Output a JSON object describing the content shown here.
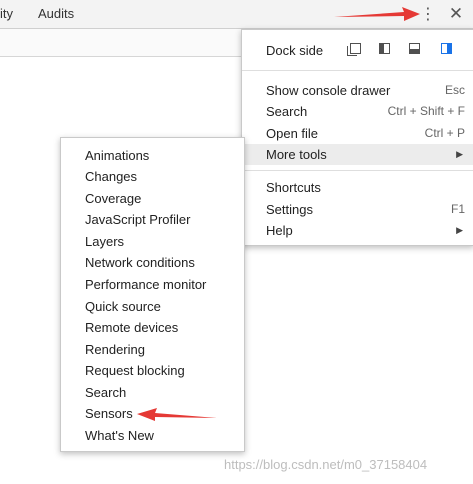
{
  "tabs": {
    "partial": "ity",
    "audits": "Audits"
  },
  "toolbar": {
    "kebab_icon": "more-vertical-icon",
    "close_icon": "close-icon",
    "kebab_glyph": "⋮",
    "close_glyph": "✕"
  },
  "main_menu": {
    "dock_side_label": "Dock side",
    "dock_options": [
      "undock-icon",
      "dock-left-icon",
      "dock-bottom-icon",
      "dock-right-icon"
    ],
    "active_dock": "dock-right-icon",
    "items": [
      {
        "label": "Show console drawer",
        "shortcut": "Esc"
      },
      {
        "label": "Search",
        "shortcut": "Ctrl + Shift + F"
      },
      {
        "label": "Open file",
        "shortcut": "Ctrl + P"
      },
      {
        "label": "More tools",
        "submenu": true,
        "highlighted": true
      },
      {
        "label": "Shortcuts"
      },
      {
        "label": "Settings",
        "shortcut": "F1"
      },
      {
        "label": "Help",
        "submenu": true
      }
    ],
    "submenu_arrow": "▶"
  },
  "more_tools_menu": {
    "items": [
      "Animations",
      "Changes",
      "Coverage",
      "JavaScript Profiler",
      "Layers",
      "Network conditions",
      "Performance monitor",
      "Quick source",
      "Remote devices",
      "Rendering",
      "Request blocking",
      "Search",
      "Sensors",
      "What's New"
    ]
  },
  "annotations": {
    "arrow_color": "#e53935"
  },
  "watermark": "https://blog.csdn.net/m0_37158404",
  "colors": {
    "accent": "#1a73e8",
    "highlight": "#ececec"
  }
}
